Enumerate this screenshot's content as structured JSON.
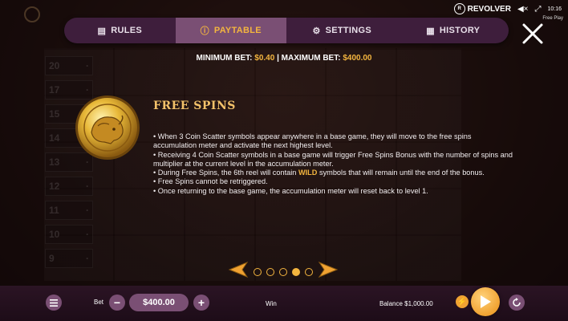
{
  "status": {
    "brand": "REVOLVER",
    "time": "10:16",
    "mode": "Free Play"
  },
  "nav": {
    "tabs": [
      {
        "label": "RULES",
        "icon": "book-icon"
      },
      {
        "label": "PAYTABLE",
        "icon": "info-icon",
        "active": true
      },
      {
        "label": "SETTINGS",
        "icon": "gear-icon"
      },
      {
        "label": "HISTORY",
        "icon": "history-icon"
      }
    ]
  },
  "bets": {
    "min_label": "MINIMUM BET:",
    "min_value": "$0.40",
    "separator": " | ",
    "max_label": "MAXIMUM BET:",
    "max_value": "$400.00"
  },
  "feature": {
    "title": "FREE SPINS",
    "symbol_icon": "bison-coin-icon",
    "lines": [
      "• When 3 Coin Scatter symbols appear anywhere in a base game, they will move to the free spins accumulation meter and activate the next highest level.",
      "• Receiving 4 Coin Scatter symbols in a base game will trigger Free Spins Bonus with the number of spins and multiplier at the current level in the accumulation meter."
    ],
    "line3_before": "• During Free Spins, the 6th reel will contain ",
    "line3_wild": "WILD",
    "line3_after": " symbols that will remain until the end of the bonus.",
    "lines_tail": [
      "• Free Spins cannot be retriggered.",
      "• Once returning to the base game, the accumulation meter will reset back to level 1."
    ]
  },
  "pager": {
    "total": 5,
    "current": 4
  },
  "bottom": {
    "bet_label": "Bet",
    "bet_value": "$400.00",
    "win_label": "Win",
    "balance_text": "Balance $1,000.00"
  },
  "background_paylines": [
    "20",
    "17",
    "15",
    "14",
    "13",
    "12",
    "11",
    "10",
    "9"
  ],
  "colors": {
    "accent": "#f3b53f",
    "nav_bg": "#3e1e3c",
    "nav_active": "#7a4f74"
  }
}
